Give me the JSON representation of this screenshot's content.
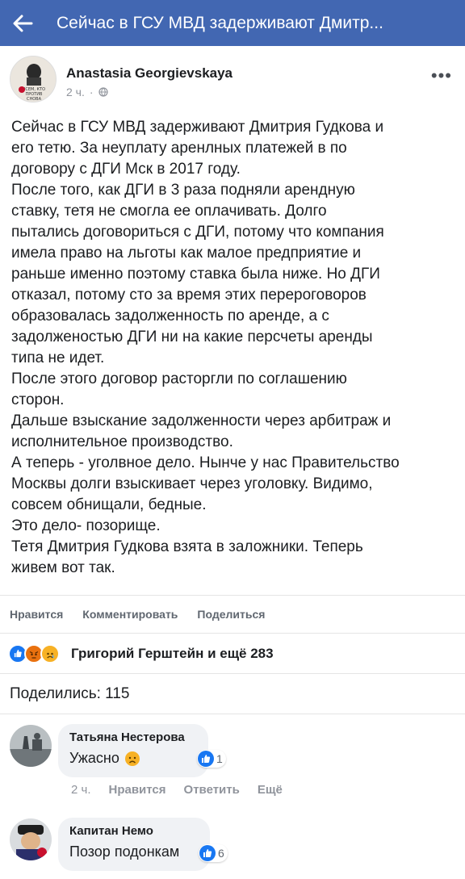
{
  "topbar": {
    "title": "Сейчас в ГСУ МВД задерживают Дмитр..."
  },
  "post": {
    "author": "Anastasia Georgievskaya",
    "time": "2 ч.",
    "avatar_text": [
      "ВСЕМ, КТО",
      "ПРОТИВ",
      "СНОВА"
    ],
    "lines": [
      "Сейчас в ГСУ МВД задерживают Дмитрия Гудкова и",
      "его тетю. За неуплату аренлных платежей в по",
      "договору с ДГИ Мск в 2017 году.",
      "После того, как ДГИ в 3 раза подняли арендную",
      "ставку, тетя не смогла ее оплачивать. Долго",
      "пытались договориться с ДГИ, потому что компания",
      "имела право на льготы как малое предприятие и",
      "раньше именно поэтому ставка была ниже. Но ДГИ",
      "отказал, потому сто за время этих перероговоров",
      "образовалась задолженность по аренде, а с",
      "задолженостью ДГИ ни на какие персчеты аренды",
      "типа не идет.",
      "После этого договор расторгли по соглашению",
      "сторон.",
      "Дальше взыскание задолженности через арбитраж и",
      "исполнительное производство.",
      "А теперь - уголвное дело. Нынче у нас Правительство",
      "Москвы долги взыскивает через уголовку. Видимо,",
      "совсем обнищали, бедные.",
      "Это дело- позорище.",
      "Тетя Дмитрия Гудкова взята в заложники. Теперь",
      "живем вот так."
    ]
  },
  "actions": {
    "like": "Нравится",
    "comment": "Комментировать",
    "share": "Поделиться"
  },
  "reactions": {
    "text": "Григорий Герштейн и ещё 283"
  },
  "shares": {
    "text": "Поделились: 115"
  },
  "comments": [
    {
      "author": "Татьяна Нестерова",
      "text": "Ужасно",
      "likes": "1",
      "time": "2 ч.",
      "like_label": "Нравится",
      "reply_label": "Ответить",
      "more_label": "Ещё"
    },
    {
      "author": "Капитан Немо",
      "text": "Позор подонкам",
      "likes": "6"
    }
  ],
  "colors": {
    "brand": "#4267b2",
    "like_blue": "#1877f2"
  }
}
